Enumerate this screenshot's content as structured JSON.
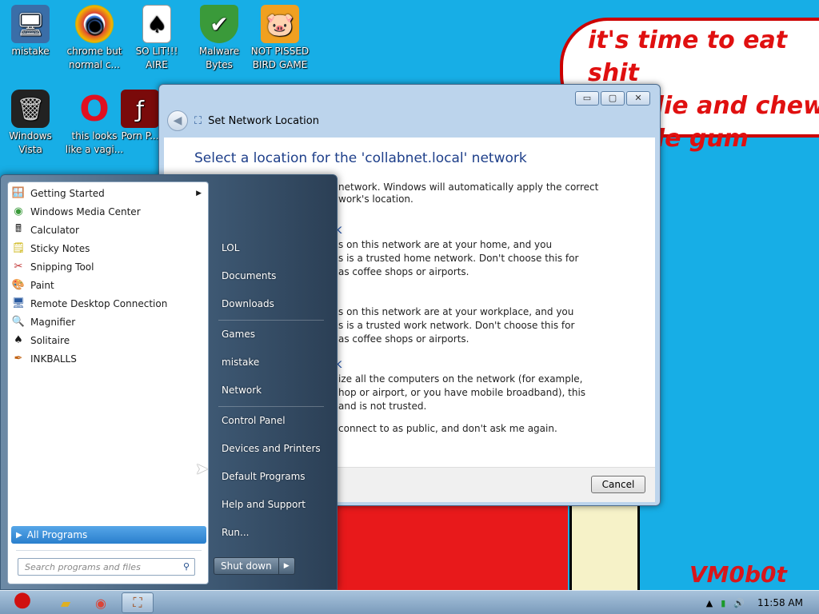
{
  "wallpaper": {
    "speech": "it's time to eat shit\nand die and chew\nbubble gum",
    "signature": "VM0b0t"
  },
  "desktop_icons": [
    {
      "id": "mistake",
      "label": "mistake",
      "icon": "monitor-shield-icon",
      "glyph": "🖥"
    },
    {
      "id": "chrome",
      "label": "chrome but normal c...",
      "icon": "chrome-icon",
      "glyph": "◉"
    },
    {
      "id": "solitaire",
      "label": "SO LIT!!! AIRE",
      "icon": "cards-icon",
      "glyph": "♠"
    },
    {
      "id": "malware",
      "label": "Malware Bytes",
      "icon": "shield-check-icon",
      "glyph": "✔"
    },
    {
      "id": "pig",
      "label": "NOT PISSED BIRD GAME",
      "icon": "pig-icon",
      "glyph": "🐷"
    },
    {
      "id": "vista",
      "label": "Windows Vista",
      "icon": "trash-icon",
      "glyph": "🗑"
    },
    {
      "id": "opera",
      "label": "this looks like a vagi...",
      "icon": "opera-icon",
      "glyph": "O"
    },
    {
      "id": "porn",
      "label": "Porn P...",
      "icon": "flash-icon",
      "glyph": "ƒ"
    }
  ],
  "window": {
    "title": "Set Network Location",
    "heading": "Select a location for the 'collabnet.local' network",
    "intro_line1": "network. Windows will automatically apply the correct",
    "intro_line2": "work's location.",
    "home_heading": "k",
    "home_line1": "s on this network are at your home, and you",
    "home_line2": "s is a trusted home network.  Don't choose this for",
    "home_line3": "as coffee shops or airports.",
    "work_line1": "s on this network are at your workplace, and you",
    "work_line2": "s is a trusted work network.  Don't choose this for",
    "work_line3": "as coffee shops or airports.",
    "public_heading": "k",
    "public_line1": "ize all the computers on the network (for example,",
    "public_line2": "hop or airport, or you have mobile broadband), this",
    "public_line3": "and is not trusted.",
    "checkbox_text": "connect to as public, and don't ask me again.",
    "cancel_label": "Cancel",
    "min_glyph": "▭",
    "max_glyph": "▢",
    "close_glyph": "✕"
  },
  "start_menu": {
    "programs": [
      {
        "label": "Getting Started",
        "icon": "getting-started-icon",
        "glyph": "🪟",
        "submenu": true
      },
      {
        "label": "Windows Media Center",
        "icon": "media-center-icon",
        "glyph": "◉",
        "submenu": false
      },
      {
        "label": "Calculator",
        "icon": "calculator-icon",
        "glyph": "🖩",
        "submenu": false
      },
      {
        "label": "Sticky Notes",
        "icon": "sticky-notes-icon",
        "glyph": "🗒",
        "submenu": false
      },
      {
        "label": "Snipping Tool",
        "icon": "scissors-icon",
        "glyph": "✂",
        "submenu": false
      },
      {
        "label": "Paint",
        "icon": "paint-icon",
        "glyph": "🎨",
        "submenu": false
      },
      {
        "label": "Remote Desktop Connection",
        "icon": "remote-desktop-icon",
        "glyph": "🖥",
        "submenu": false
      },
      {
        "label": "Magnifier",
        "icon": "magnifier-icon",
        "glyph": "🔍",
        "submenu": false
      },
      {
        "label": "Solitaire",
        "icon": "cards-icon",
        "glyph": "♠",
        "submenu": false
      },
      {
        "label": "INKBALLS",
        "icon": "ink-icon",
        "glyph": "✒",
        "submenu": false
      }
    ],
    "all_programs": "All Programs",
    "search_placeholder": "Search programs and files",
    "right_links": [
      {
        "label": "LOL"
      },
      {
        "label": "Documents"
      },
      {
        "label": "Downloads"
      },
      {
        "label": "Games"
      },
      {
        "label": "mistake"
      },
      {
        "label": "Network"
      },
      {
        "label": "Control Panel"
      },
      {
        "label": "Devices and Printers"
      },
      {
        "label": "Default Programs"
      },
      {
        "label": "Help and Support"
      },
      {
        "label": "Run..."
      }
    ],
    "shutdown_label": "Shut down",
    "shutdown_arrow": "▶",
    "submenu_arrow": "▶",
    "all_programs_arrow": "▶"
  },
  "taskbar": {
    "clock": "11:58 AM",
    "tray_up": "▲",
    "volume_glyph": "🔊",
    "network_glyph": "▮"
  }
}
